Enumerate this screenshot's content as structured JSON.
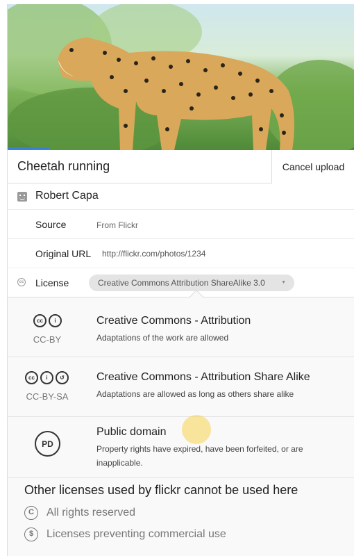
{
  "photo": {
    "alt_icon": "cheetah-photo",
    "upload_progress": 0.12
  },
  "title_row": {
    "title": "Cheetah running",
    "cancel_label": "Cancel upload"
  },
  "author": {
    "name": "Robert Capa",
    "icon": "user-face-icon"
  },
  "source": {
    "label": "Source",
    "value": "From Flickr"
  },
  "original_url": {
    "label": "Original URL",
    "value": "http://flickr.com/photos/1234"
  },
  "license": {
    "label": "License",
    "icon": "cc-small-icon",
    "selected": "Creative Commons Attribution ShareAlike 3.0",
    "caret": "▼"
  },
  "options": [
    {
      "code": "CC-BY",
      "title": "Creative Commons - Attribution",
      "description": "Adaptations of the work are allowed",
      "icons": [
        "cc",
        "by"
      ]
    },
    {
      "code": "CC-BY-SA",
      "title": "Creative Commons - Attribution Share Alike",
      "description": "Adaptations are allowed as long as others share alike",
      "icons": [
        "cc",
        "by",
        "sa"
      ]
    },
    {
      "code": "PD",
      "title": "Public domain",
      "description": "Property rights have expired, have been forfeited, or are inapplicable."
    }
  ],
  "other": {
    "title": "Other licenses used by flickr cannot be used here",
    "items": [
      {
        "label": "All rights reserved",
        "glyph": "C"
      },
      {
        "label": "Licenses preventing commercial use",
        "glyph": "$"
      }
    ]
  },
  "colors": {
    "progress": "#3b82d6",
    "select_bg": "#e4e4e4",
    "options_bg": "#f9f9f9",
    "cursor": "#fad450"
  }
}
